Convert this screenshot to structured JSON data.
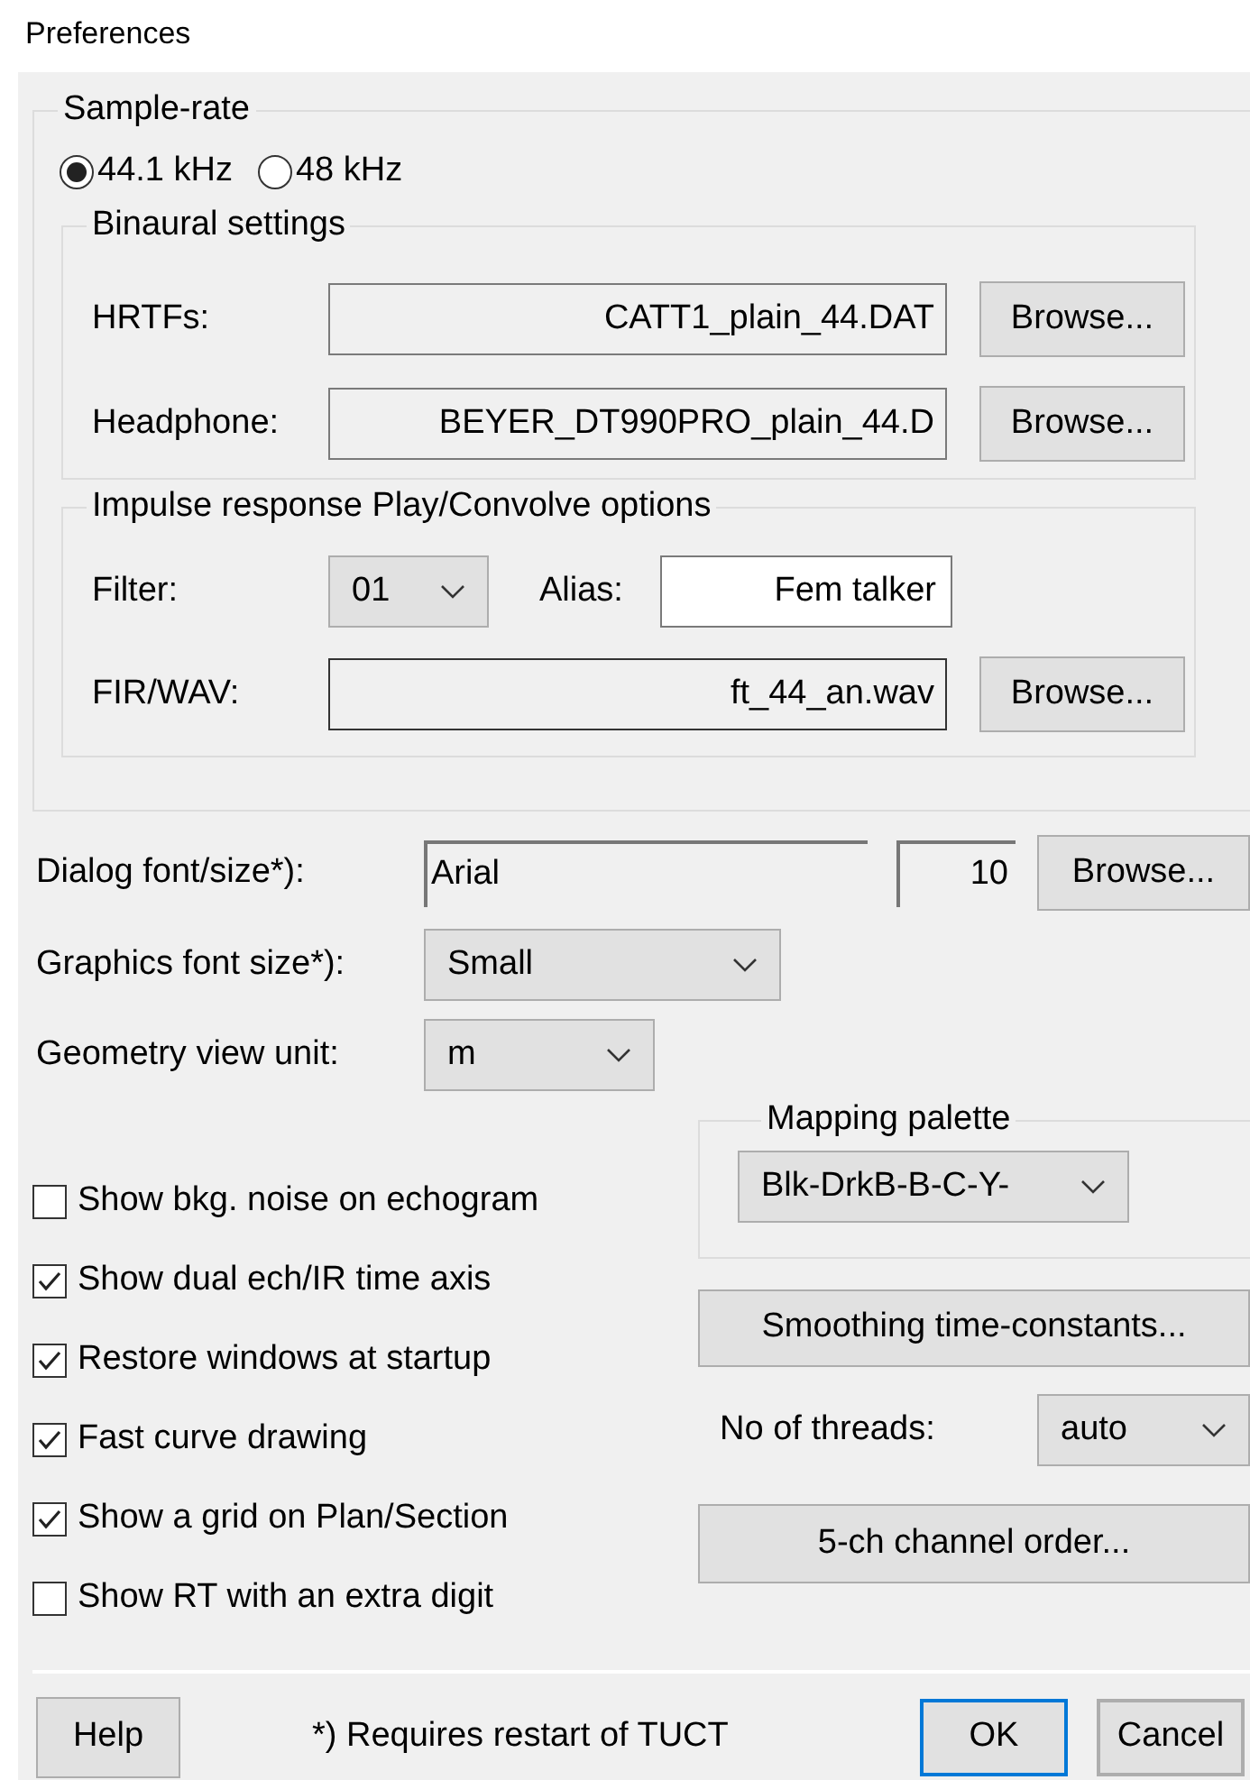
{
  "window": {
    "title": "Preferences"
  },
  "sample_rate": {
    "label": "Sample-rate",
    "options": [
      {
        "label": "44.1 kHz",
        "selected": true
      },
      {
        "label": "48 kHz",
        "selected": false
      }
    ]
  },
  "binaural": {
    "label": "Binaural settings",
    "rows": [
      {
        "label": "HRTFs:",
        "value": "CATT1_plain_44.DAT",
        "button": "Browse..."
      },
      {
        "label": "Headphone:",
        "value": "BEYER_DT990PRO_plain_44.D",
        "button": "Browse..."
      }
    ]
  },
  "impulse": {
    "label": "Impulse response Play/Convolve options",
    "filter": {
      "label": "Filter:",
      "value": "01"
    },
    "alias": {
      "label": "Alias:",
      "value": "Fem talker"
    },
    "fir": {
      "label": "FIR/WAV:",
      "value": "ft_44_an.wav",
      "button": "Browse..."
    }
  },
  "dialog_font": {
    "label": "Dialog font/size*):",
    "font": "Arial",
    "size": "10",
    "button": "Browse..."
  },
  "graphics_font_size": {
    "label": "Graphics font size*):",
    "value": "Small"
  },
  "geometry_view_unit": {
    "label": "Geometry view unit:",
    "value": "m"
  },
  "checkboxes": [
    {
      "label": "Show bkg. noise on echogram",
      "checked": false
    },
    {
      "label": "Show dual ech/IR time axis",
      "checked": true
    },
    {
      "label": "Restore windows at startup",
      "checked": true
    },
    {
      "label": "Fast curve drawing",
      "checked": true
    },
    {
      "label": "Show a grid on Plan/Section",
      "checked": true
    },
    {
      "label": "Show RT with an extra digit",
      "checked": false
    }
  ],
  "mapping_palette": {
    "label": "Mapping palette",
    "value": "Blk-DrkB-B-C-Y-"
  },
  "smoothing_button": "Smoothing time-constants...",
  "threads": {
    "label": "No of threads:",
    "value": "auto"
  },
  "channel_order_button": "5-ch channel order...",
  "footer": {
    "left_button": {
      "label": "Help"
    },
    "note": "*) Requires restart of TUCT",
    "right_buttons": [
      {
        "label": "OK",
        "default": true
      },
      {
        "label": "Cancel",
        "default": false
      }
    ]
  }
}
